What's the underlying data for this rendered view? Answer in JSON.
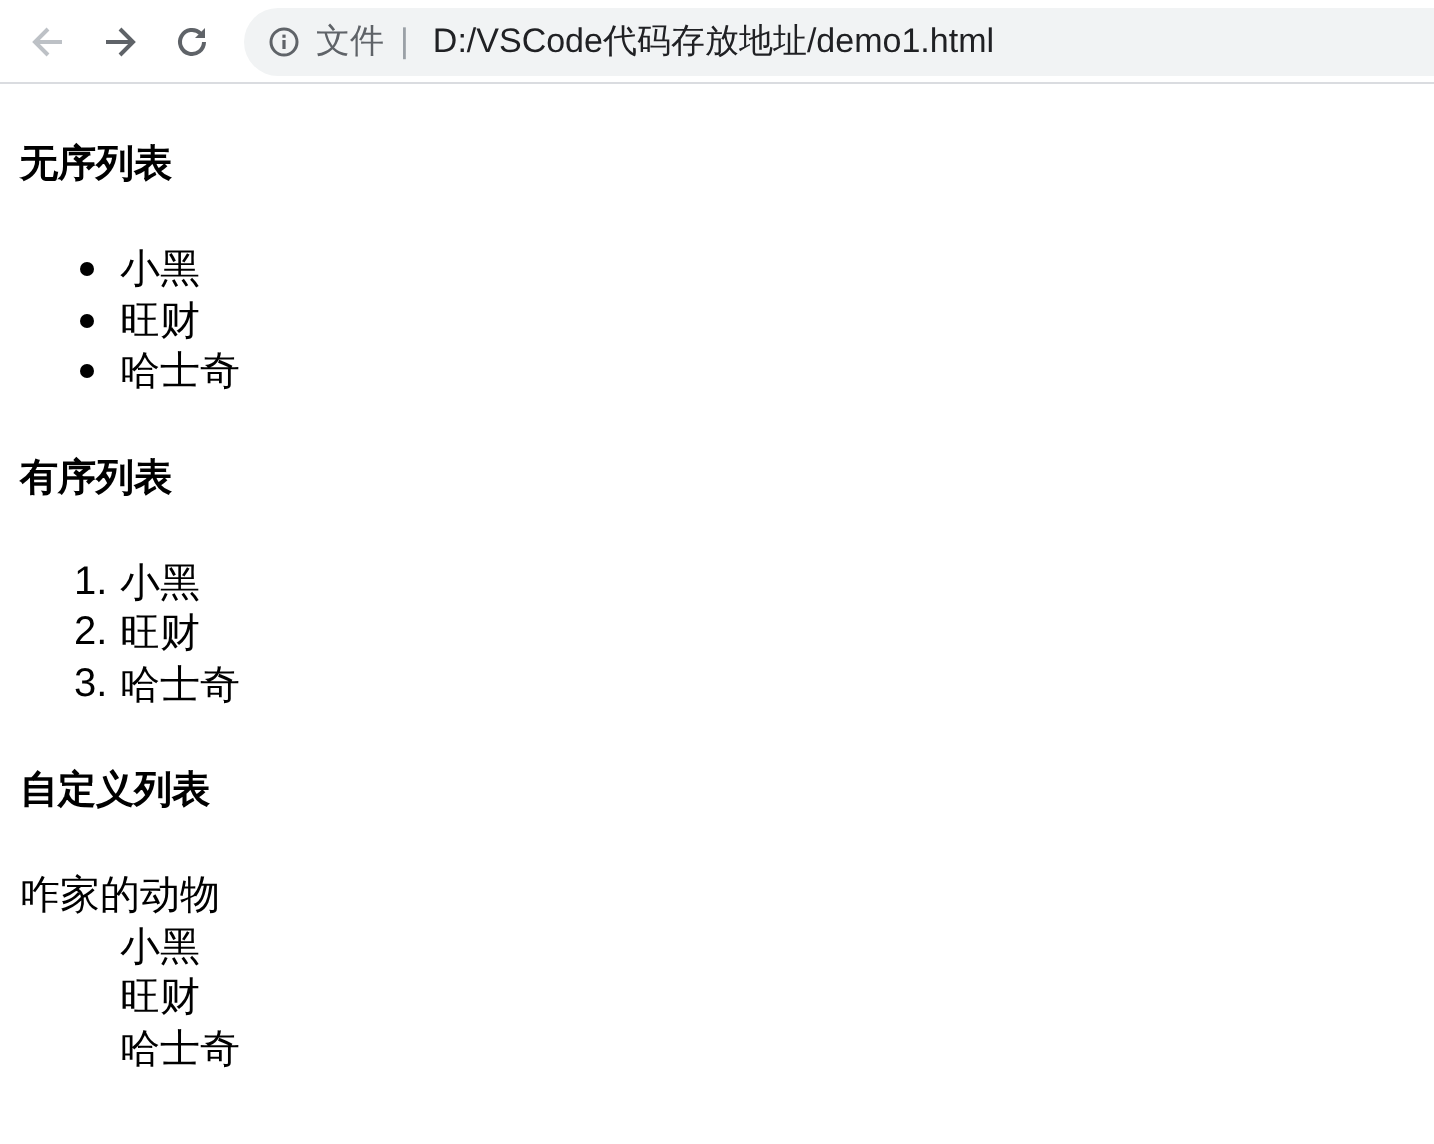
{
  "toolbar": {
    "buttons": [
      {
        "kind": "back",
        "disabled": true
      },
      {
        "kind": "forward",
        "disabled": false
      },
      {
        "kind": "reload",
        "disabled": false
      }
    ]
  },
  "address_bar": {
    "scheme_label": "文件",
    "separator": "|",
    "url": "D:/VSCode代码存放地址/demo1.html"
  },
  "sections": [
    {
      "heading": "无序列表",
      "kind": "unordered",
      "items": [
        "小黑",
        "旺财",
        "哈士奇"
      ]
    },
    {
      "heading": "有序列表",
      "kind": "ordered",
      "items": [
        {
          "marker": "1.",
          "text": "小黑"
        },
        {
          "marker": "2.",
          "text": "旺财"
        },
        {
          "marker": "3.",
          "text": "哈士奇"
        }
      ]
    },
    {
      "heading": "自定义列表",
      "kind": "definition",
      "term": "咋家的动物",
      "items": [
        "小黑",
        "旺财",
        "哈士奇"
      ]
    }
  ]
}
